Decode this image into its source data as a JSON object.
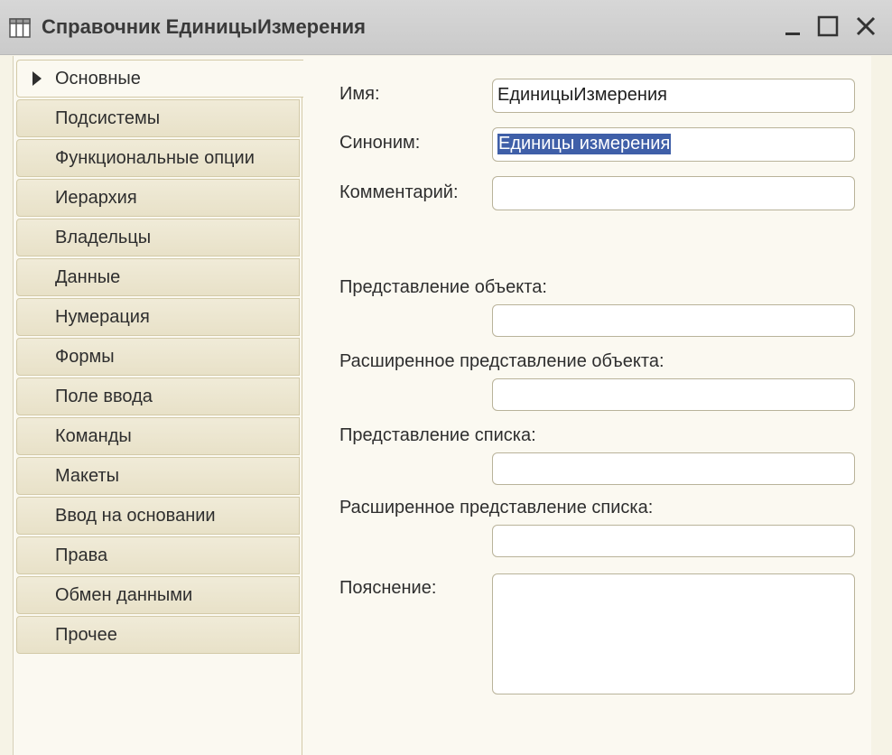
{
  "window": {
    "title": "Справочник ЕдиницыИзмерения",
    "icon": "catalog-table-icon",
    "controls": [
      "minimize-icon",
      "maximize-icon",
      "close-icon"
    ]
  },
  "tabs": [
    {
      "label": "Основные",
      "active": true
    },
    {
      "label": "Подсистемы"
    },
    {
      "label": "Функциональные опции"
    },
    {
      "label": "Иерархия"
    },
    {
      "label": "Владельцы"
    },
    {
      "label": "Данные"
    },
    {
      "label": "Нумерация"
    },
    {
      "label": "Формы"
    },
    {
      "label": "Поле ввода"
    },
    {
      "label": "Команды"
    },
    {
      "label": "Макеты"
    },
    {
      "label": "Ввод на основании"
    },
    {
      "label": "Права"
    },
    {
      "label": "Обмен данными"
    },
    {
      "label": "Прочее"
    }
  ],
  "form": {
    "name": {
      "label": "Имя:",
      "value": "ЕдиницыИзмерения"
    },
    "synonym": {
      "label": "Синоним:",
      "value": "Единицы измерения"
    },
    "comment": {
      "label": "Комментарий:",
      "value": ""
    },
    "object_presentation": {
      "label": "Представление объекта:",
      "value": ""
    },
    "extended_object_presentation": {
      "label": "Расширенное представление объекта:",
      "value": ""
    },
    "list_presentation": {
      "label": "Представление списка:",
      "value": ""
    },
    "extended_list_presentation": {
      "label": "Расширенное представление списка:",
      "value": ""
    },
    "explanation": {
      "label": "Пояснение:",
      "value": ""
    }
  },
  "colors": {
    "selection": "#3f5fa8",
    "tab_background": "#ece6cf",
    "panel_background": "#fbf9f1"
  }
}
